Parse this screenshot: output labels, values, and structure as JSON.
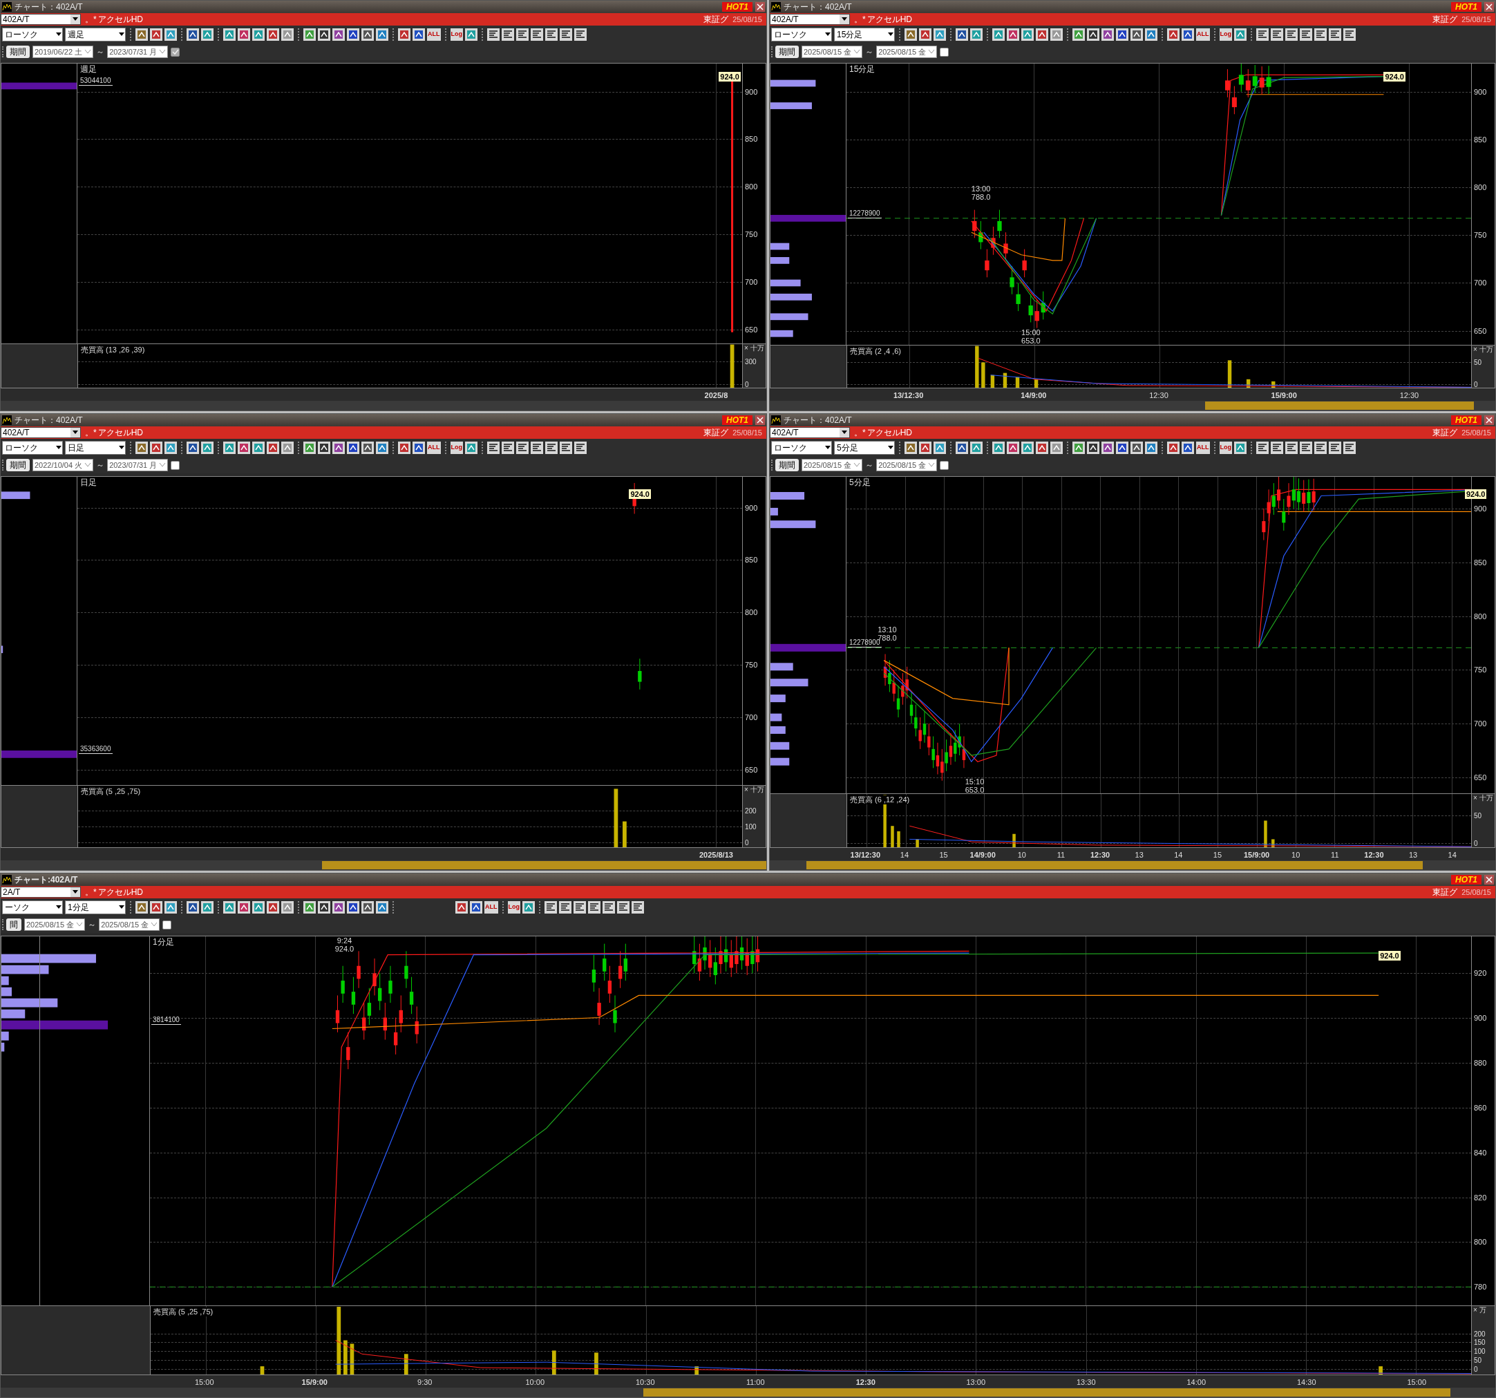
{
  "windows": [
    {
      "title": "チャート：402A/T",
      "hot": "HOT1",
      "code": "402A/T",
      "mark": "。*",
      "name": "アクセルHD",
      "exchange": "東証グ",
      "date": "25/08/15",
      "chart_type": "ローソク",
      "interval": "週足",
      "toolbar_labels": [
        "ALL",
        "Log"
      ],
      "period_button": "期間",
      "from": "2019/06/22 土",
      "separator": "～",
      "to": "2023/07/31 月",
      "period_checked": true,
      "pane_label": "週足",
      "profile_value": "53044100",
      "last_price": "924.0",
      "price_ticks": [
        "900",
        "850",
        "800",
        "750",
        "700",
        "650"
      ],
      "volume_label": "売買高 (13 ,26 ,39)",
      "volume_unit": "× 十万",
      "volume_ticks": [
        "300",
        "0"
      ],
      "x_labels": [
        {
          "text": "2025/8",
          "bold": true
        }
      ]
    },
    {
      "title": "チャート：402A/T",
      "hot": "HOT1",
      "code": "402A/T",
      "mark": "。*",
      "name": "アクセルHD",
      "exchange": "東証グ",
      "date": "25/08/15",
      "chart_type": "ローソク",
      "interval": "15分足",
      "toolbar_labels": [
        "ALL",
        "Log"
      ],
      "period_button": "期間",
      "from": "2025/08/15 金",
      "separator": "～",
      "to": "2025/08/15 金",
      "period_checked": false,
      "pane_label": "15分足",
      "profile_value": "12278900",
      "last_price": "924.0",
      "price_ticks": [
        "900",
        "850",
        "800",
        "750",
        "700",
        "650"
      ],
      "annotations": [
        "13:00\n788.0",
        "15:00\n653.0"
      ],
      "volume_label": "売買高 (2 ,4 ,6)",
      "volume_unit": "× 十万",
      "volume_ticks": [
        "50",
        "0"
      ],
      "x_labels": [
        {
          "text": "13/12:30",
          "bold": true
        },
        {
          "text": "14/9:00",
          "bold": true
        },
        {
          "text": "12:30",
          "bold": false
        },
        {
          "text": "15/9:00",
          "bold": true
        },
        {
          "text": "12:30",
          "bold": false
        }
      ]
    },
    {
      "title": "チャート：402A/T",
      "hot": "HOT1",
      "code": "402A/T",
      "mark": "。*",
      "name": "アクセルHD",
      "exchange": "東証グ",
      "date": "25/08/15",
      "chart_type": "ローソク",
      "interval": "日足",
      "toolbar_labels": [
        "ALL",
        "Log"
      ],
      "period_button": "期間",
      "from": "2022/10/04 火",
      "separator": "～",
      "to": "2023/07/31 月",
      "period_checked": false,
      "pane_label": "日足",
      "profile_value": "35363600",
      "last_price": "924.0",
      "price_ticks": [
        "900",
        "850",
        "800",
        "750",
        "700",
        "650"
      ],
      "volume_label": "売買高 (5 ,25 ,75)",
      "volume_unit": "× 十万",
      "volume_ticks": [
        "200",
        "100",
        "0"
      ],
      "x_labels": [
        {
          "text": "2025/8/13",
          "bold": true
        }
      ]
    },
    {
      "title": "チャート：402A/T",
      "hot": "HOT1",
      "code": "402A/T",
      "mark": "。*",
      "name": "アクセルHD",
      "exchange": "東証グ",
      "date": "25/08/15",
      "chart_type": "ローソク",
      "interval": "5分足",
      "toolbar_labels": [
        "ALL",
        "Log"
      ],
      "period_button": "期間",
      "from": "2025/08/15 金",
      "separator": "～",
      "to": "2025/08/15 金",
      "period_checked": false,
      "pane_label": "5分足",
      "profile_value": "12278900",
      "last_price": "924.0",
      "price_ticks": [
        "900",
        "850",
        "800",
        "750",
        "700",
        "650"
      ],
      "annotations": [
        "13:10\n788.0",
        "15:10\n653.0"
      ],
      "volume_label": "売買高 (6 ,12 ,24)",
      "volume_unit": "× 十万",
      "volume_ticks": [
        "50",
        "0"
      ],
      "x_labels": [
        {
          "text": "13/12:30",
          "bold": true
        },
        {
          "text": "14",
          "bold": false
        },
        {
          "text": "15",
          "bold": false
        },
        {
          "text": "14/9:00",
          "bold": true
        },
        {
          "text": "10",
          "bold": false
        },
        {
          "text": "11",
          "bold": false
        },
        {
          "text": "12:30",
          "bold": true
        },
        {
          "text": "13",
          "bold": false
        },
        {
          "text": "14",
          "bold": false
        },
        {
          "text": "15",
          "bold": false
        },
        {
          "text": "15/9:00",
          "bold": true
        },
        {
          "text": "10",
          "bold": false
        },
        {
          "text": "11",
          "bold": false
        },
        {
          "text": "12:30",
          "bold": true
        },
        {
          "text": "13",
          "bold": false
        },
        {
          "text": "14",
          "bold": false
        }
      ]
    },
    {
      "title": "チャート:402A/T",
      "hot": "HOT1",
      "code": "2A/T",
      "mark": "。*",
      "name": "アクセルHD",
      "exchange": "東証グ",
      "date": "25/08/15",
      "chart_type": "ーソク",
      "interval": "1分足",
      "toolbar_labels": [
        "ALL",
        "Log"
      ],
      "period_button": "間",
      "from": "2025/08/15 金",
      "separator": "～",
      "to": "2025/08/15 金",
      "period_checked": false,
      "pane_label": "1分足",
      "profile_value": "3814100",
      "last_price": "924.0",
      "price_ticks": [
        "920",
        "900",
        "880",
        "860",
        "840",
        "820",
        "800",
        "780"
      ],
      "annotations": [
        "9:24\n924.0"
      ],
      "volume_label": "売買高 (5 ,25 ,75)",
      "volume_unit": "× 万",
      "volume_ticks": [
        "200",
        "150",
        "100",
        "50",
        "0"
      ],
      "x_labels": [
        {
          "text": "15:00",
          "bold": false
        },
        {
          "text": "15/9:00",
          "bold": true
        },
        {
          "text": "9:30",
          "bold": false
        },
        {
          "text": "10:00",
          "bold": false
        },
        {
          "text": "10:30",
          "bold": false
        },
        {
          "text": "11:00",
          "bold": false
        },
        {
          "text": "12:30",
          "bold": true
        },
        {
          "text": "13:00",
          "bold": false
        },
        {
          "text": "13:30",
          "bold": false
        },
        {
          "text": "14:00",
          "bold": false
        },
        {
          "text": "14:30",
          "bold": false
        },
        {
          "text": "15:00",
          "bold": false
        }
      ]
    }
  ]
}
